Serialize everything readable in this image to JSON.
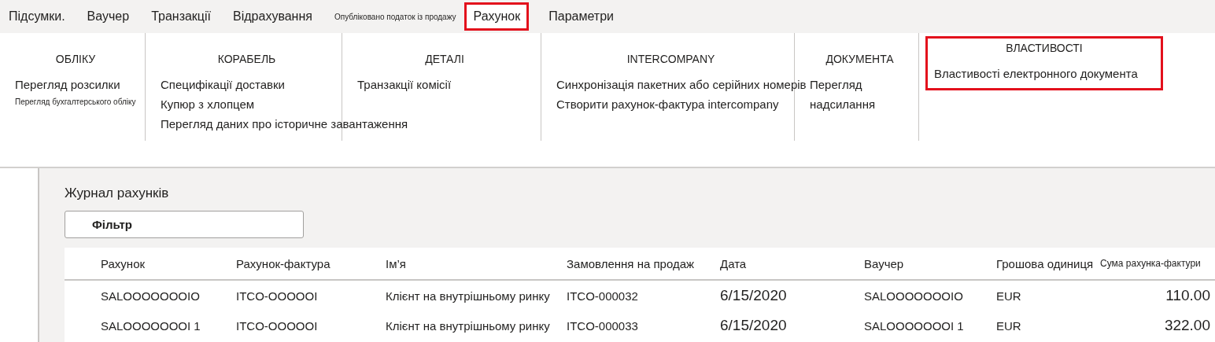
{
  "tabs": [
    {
      "label": "Підсумки.",
      "kind": "tab",
      "selected": false,
      "highlighted": false
    },
    {
      "label": "Ваучер",
      "kind": "tab",
      "selected": false,
      "highlighted": false
    },
    {
      "label": "Транзакції",
      "kind": "tab",
      "selected": false,
      "highlighted": false
    },
    {
      "label": "Відрахування",
      "kind": "tab",
      "selected": false,
      "highlighted": false
    },
    {
      "label": "Опубліковано податок із продажу",
      "kind": "small-tab",
      "selected": false,
      "highlighted": false
    },
    {
      "label": "Рахунок",
      "kind": "tab",
      "selected": true,
      "highlighted": true
    },
    {
      "label": "Параметри",
      "kind": "tab",
      "selected": false,
      "highlighted": false
    }
  ],
  "ribbon": {
    "groups": [
      {
        "title": "ОБЛІКУ",
        "highlighted": false,
        "items": [
          {
            "label": "Перегляд розсилки",
            "kind": "normal"
          },
          {
            "label": "Перегляд бухгалтерського обліку",
            "kind": "small"
          }
        ]
      },
      {
        "title": "КОРАБЕЛЬ",
        "highlighted": false,
        "items": [
          {
            "label": "Специфікації доставки",
            "kind": "normal"
          },
          {
            "label": "Купюр з хлопцем",
            "kind": "normal"
          },
          {
            "label": "Перегляд даних про історичне завантаження",
            "kind": "normal"
          }
        ]
      },
      {
        "title": "ДЕТАЛІ",
        "highlighted": false,
        "items": [
          {
            "label": "Транзакції комісії",
            "kind": "normal"
          }
        ]
      },
      {
        "title": "INTERCOMPANY",
        "highlighted": false,
        "items": [
          {
            "label": "Синхронізація пакетних або серійних номерів",
            "kind": "normal"
          },
          {
            "label": "Створити рахунок-фактура intercompany",
            "kind": "normal"
          }
        ]
      },
      {
        "title": "ДОКУМЕНТА",
        "highlighted": false,
        "items": [
          {
            "label": "Перегляд",
            "kind": "normal"
          },
          {
            "label": "надсилання",
            "kind": "normal"
          }
        ]
      },
      {
        "title": "ВЛАСТИВОСТІ",
        "highlighted": true,
        "items": [
          {
            "label": "Властивості електронного документа",
            "kind": "normal"
          }
        ]
      }
    ]
  },
  "journal": {
    "title": "Журнал рахунків",
    "filter": {
      "placeholder": "Фільтр"
    },
    "table": {
      "columns": [
        "Рахунок",
        "Рахунок-фактура",
        "Ім’я",
        "Замовлення на продаж",
        "Дата",
        "Ваучер",
        "Грошова одиниця",
        "Сума рахунка-фактури"
      ],
      "rows": [
        [
          "SALOOOOOOOIO",
          "ITCO-OOOOOI",
          "Клієнт на внутрішньому ринку",
          "ITCO-000032",
          "6/15/2020",
          "SALOOOOOOOIO",
          "EUR",
          "110.00"
        ],
        [
          "SALOOOOOOOI 1",
          "ITCO-OOOOOI",
          "Клієнт на внутрішньому ринку",
          "ITCO-000033",
          "6/15/2020",
          "SALOOOOOOOI 1",
          "EUR",
          "322.00"
        ]
      ]
    }
  }
}
